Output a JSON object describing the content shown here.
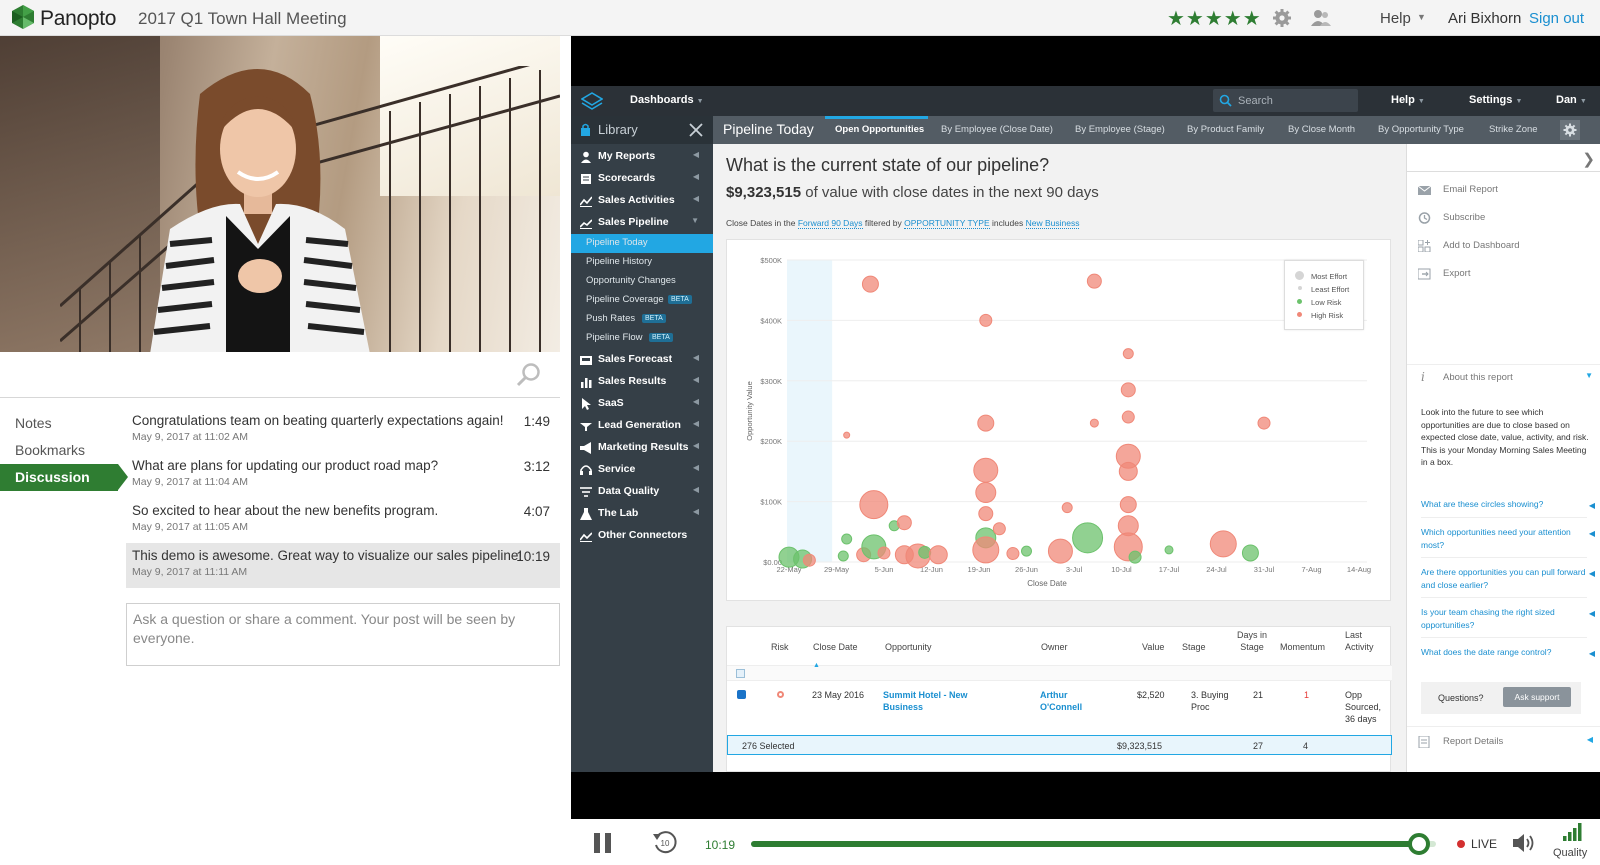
{
  "header": {
    "brand": "Panopto",
    "session_title": "2017 Q1 Town Hall Meeting",
    "rating": "★★★★★",
    "help": "Help",
    "user": "Ari Bixhorn",
    "sign_out": "Sign out"
  },
  "left_tabs": [
    {
      "label": "Notes"
    },
    {
      "label": "Bookmarks"
    },
    {
      "label": "Discussion"
    }
  ],
  "comments": [
    {
      "text": "Congratulations team on beating quarterly expectations again!",
      "time": "1:49",
      "date": "May 9, 2017 at 11:02 AM"
    },
    {
      "text": "What are plans for updating our product road map?",
      "time": "3:12",
      "date": "May 9, 2017 at 11:04 AM"
    },
    {
      "text": "So excited to hear about the new benefits program.",
      "time": "4:07",
      "date": "May 9, 2017 at 11:05 AM"
    },
    {
      "text": "This demo is awesome. Great way to visualize our sales pipeline!",
      "time": "10:19",
      "date": "May 9, 2017 at 11:11 AM"
    }
  ],
  "comment_box": {
    "placeholder": "Ask a question or share a comment. Your post will be seen by everyone."
  },
  "app": {
    "dashboards": "Dashboards",
    "search_placeholder": "Search",
    "help": "Help",
    "settings": "Settings",
    "user": "Dan",
    "library": "Library",
    "nav": [
      {
        "label": "My Reports",
        "icon": "user-icon"
      },
      {
        "label": "Scorecards",
        "icon": "scorecard-icon"
      },
      {
        "label": "Sales Activities",
        "icon": "activities-icon"
      },
      {
        "label": "Sales Pipeline",
        "icon": "pipeline-icon"
      },
      {
        "label": "Sales Forecast",
        "icon": "forecast-icon"
      },
      {
        "label": "Sales Results",
        "icon": "bar-chart-icon"
      },
      {
        "label": "SaaS",
        "icon": "cursor-icon"
      },
      {
        "label": "Lead Generation",
        "icon": "lead-icon"
      },
      {
        "label": "Marketing Results",
        "icon": "megaphone-icon"
      },
      {
        "label": "Service",
        "icon": "headset-icon"
      },
      {
        "label": "Data Quality",
        "icon": "filter-icon"
      },
      {
        "label": "The Lab",
        "icon": "flask-icon"
      },
      {
        "label": "Other Connectors",
        "icon": "connector-icon"
      }
    ],
    "sub_nav": [
      {
        "label": "Pipeline Today",
        "beta": ""
      },
      {
        "label": "Pipeline History",
        "beta": ""
      },
      {
        "label": "Opportunity Changes",
        "beta": ""
      },
      {
        "label": "Pipeline Coverage",
        "beta": "BETA"
      },
      {
        "label": "Push Rates",
        "beta": "BETA"
      },
      {
        "label": "Pipeline Flow",
        "beta": "BETA"
      }
    ],
    "report_title": "Pipeline Today",
    "tabs": [
      "Open Opportunities",
      "By Employee (Close Date)",
      "By Employee (Stage)",
      "By Product Family",
      "By Close Month",
      "By Opportunity Type",
      "Strike Zone"
    ],
    "question": "What is the current state of our pipeline?",
    "summary_value": "$9,323,515",
    "summary_text": "of value with close dates in the next 90 days",
    "filter": {
      "prefix": "Close Dates in the",
      "range": "Forward 90 Days",
      "filtered_by": "filtered by",
      "field": "OPPORTUNITY TYPE",
      "includes": "includes",
      "value": "New Business"
    },
    "grid": {
      "headers": [
        "Risk",
        "Close Date",
        "Opportunity",
        "Owner",
        "Value",
        "Stage",
        "Days in Stage",
        "Momentum",
        "Last Activity"
      ],
      "row": {
        "close_date": "23 May 2016",
        "opportunity": "Summit Hotel - New Business",
        "owner": "Arthur O'Connell",
        "value": "$2,520",
        "stage": "3. Buying Proc",
        "days": "21",
        "momentum": "1",
        "last_activity": "Opp Sourced, 36 days ago"
      },
      "footer": {
        "selected": "276 Selected",
        "value": "$9,323,515",
        "days": "27",
        "momentum": "4"
      }
    },
    "right_panel": {
      "actions": [
        {
          "label": "Email Report",
          "icon": "envelope-icon"
        },
        {
          "label": "Subscribe",
          "icon": "history-icon"
        },
        {
          "label": "Add to Dashboard",
          "icon": "dashboard-add-icon"
        },
        {
          "label": "Export",
          "icon": "export-icon"
        }
      ],
      "about": "About this report",
      "description": "Look into the future to see which opportunities are due to close based on expected close date, value, activity, and risk. This is your Monday Morning Sales Meeting in a box.",
      "questions": [
        "What are these circles showing?",
        "Which opportunities need your attention most?",
        "Are there opportunities you can pull forward and close earlier?",
        "Is your team chasing the right sized opportunities?",
        "What does the date range control?"
      ],
      "questions_label": "Questions?",
      "ask_support": "Ask support",
      "report_details": "Report Details"
    }
  },
  "player": {
    "current_time": "10:19",
    "progress": 0.975,
    "live": "LIVE",
    "quality": "Quality"
  },
  "chart_data": {
    "type": "scatter",
    "title": "",
    "xlabel": "Close Date",
    "ylabel": "Opportunity Value",
    "x_ticks": [
      "22-May",
      "29-May",
      "5-Jun",
      "12-Jun",
      "19-Jun",
      "26-Jun",
      "3-Jul",
      "10-Jul",
      "17-Jul",
      "24-Jul",
      "31-Jul",
      "7-Aug",
      "14-Aug"
    ],
    "y_ticks": [
      "$0.00",
      "$100K",
      "$200K",
      "$300K",
      "$400K",
      "$500K"
    ],
    "ylim": [
      0,
      500000
    ],
    "x_unit": "days since 22-May",
    "legend": [
      "Most Effort",
      "Least Effort",
      "Low Risk",
      "High Risk"
    ],
    "legend_position": "top-right",
    "colors": {
      "high_risk": "#f08878",
      "low_risk": "#6cc26c",
      "most_effort": "#d5d5d5",
      "least_effort": "#d5d5d5"
    },
    "points": [
      {
        "x": 0,
        "y": 8000,
        "s": 10,
        "risk": "low"
      },
      {
        "x": 2,
        "y": 5000,
        "s": 9,
        "risk": "low"
      },
      {
        "x": 3,
        "y": 3000,
        "s": 6,
        "risk": "high"
      },
      {
        "x": 8.5,
        "y": 210000,
        "s": 3,
        "risk": "high"
      },
      {
        "x": 8,
        "y": 10000,
        "s": 5,
        "risk": "low"
      },
      {
        "x": 8.5,
        "y": 38000,
        "s": 5,
        "risk": "low"
      },
      {
        "x": 12,
        "y": 460000,
        "s": 8,
        "risk": "high"
      },
      {
        "x": 11,
        "y": 12000,
        "s": 7,
        "risk": "high"
      },
      {
        "x": 12.5,
        "y": 25000,
        "s": 12,
        "risk": "low"
      },
      {
        "x": 12.5,
        "y": 95000,
        "s": 14,
        "risk": "high"
      },
      {
        "x": 14,
        "y": 15000,
        "s": 6,
        "risk": "high"
      },
      {
        "x": 15.5,
        "y": 60000,
        "s": 5,
        "risk": "low"
      },
      {
        "x": 17,
        "y": 65000,
        "s": 7,
        "risk": "high"
      },
      {
        "x": 17,
        "y": 12000,
        "s": 9,
        "risk": "high"
      },
      {
        "x": 19,
        "y": 10000,
        "s": 12,
        "risk": "high"
      },
      {
        "x": 20,
        "y": 16000,
        "s": 6,
        "risk": "low"
      },
      {
        "x": 22,
        "y": 12000,
        "s": 9,
        "risk": "high"
      },
      {
        "x": 29,
        "y": 400000,
        "s": 6,
        "risk": "high"
      },
      {
        "x": 29,
        "y": 230000,
        "s": 8,
        "risk": "high"
      },
      {
        "x": 29,
        "y": 152000,
        "s": 12,
        "risk": "high"
      },
      {
        "x": 29,
        "y": 115000,
        "s": 10,
        "risk": "high"
      },
      {
        "x": 29,
        "y": 80000,
        "s": 7,
        "risk": "high"
      },
      {
        "x": 29,
        "y": 40000,
        "s": 10,
        "risk": "low"
      },
      {
        "x": 29,
        "y": 20000,
        "s": 13,
        "risk": "high"
      },
      {
        "x": 31,
        "y": 55000,
        "s": 6,
        "risk": "high"
      },
      {
        "x": 33,
        "y": 14000,
        "s": 6,
        "risk": "high"
      },
      {
        "x": 35,
        "y": 18000,
        "s": 5,
        "risk": "low"
      },
      {
        "x": 40,
        "y": 18000,
        "s": 12,
        "risk": "high"
      },
      {
        "x": 41,
        "y": 90000,
        "s": 5,
        "risk": "high"
      },
      {
        "x": 44,
        "y": 40000,
        "s": 15,
        "risk": "low"
      },
      {
        "x": 45,
        "y": 465000,
        "s": 7,
        "risk": "high"
      },
      {
        "x": 45,
        "y": 230000,
        "s": 4,
        "risk": "high"
      },
      {
        "x": 50,
        "y": 345000,
        "s": 5,
        "risk": "high"
      },
      {
        "x": 50,
        "y": 285000,
        "s": 7,
        "risk": "high"
      },
      {
        "x": 50,
        "y": 240000,
        "s": 6,
        "risk": "high"
      },
      {
        "x": 50,
        "y": 175000,
        "s": 12,
        "risk": "high"
      },
      {
        "x": 50,
        "y": 150000,
        "s": 9,
        "risk": "high"
      },
      {
        "x": 50,
        "y": 95000,
        "s": 8,
        "risk": "high"
      },
      {
        "x": 50,
        "y": 60000,
        "s": 10,
        "risk": "high"
      },
      {
        "x": 50,
        "y": 25000,
        "s": 14,
        "risk": "high"
      },
      {
        "x": 51,
        "y": 8000,
        "s": 6,
        "risk": "low"
      },
      {
        "x": 56,
        "y": 20000,
        "s": 4,
        "risk": "low"
      },
      {
        "x": 64,
        "y": 30000,
        "s": 13,
        "risk": "high"
      },
      {
        "x": 68,
        "y": 15000,
        "s": 8,
        "risk": "low"
      },
      {
        "x": 70,
        "y": 230000,
        "s": 6,
        "risk": "high"
      }
    ]
  }
}
